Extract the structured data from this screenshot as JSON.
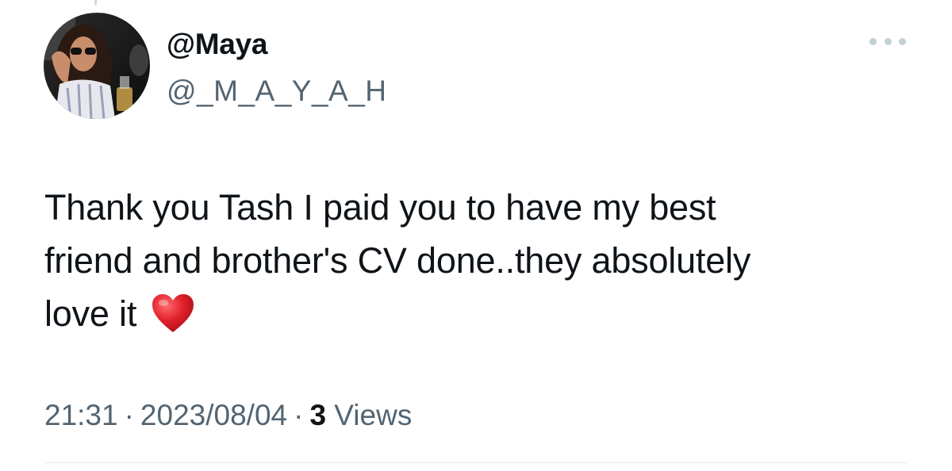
{
  "tweet": {
    "display_name": "@Maya",
    "handle": "@_M_A_Y_A_H",
    "more_icon": "more-horizontal-icon",
    "text_lines": [
      "Thank you Tash I paid you to have my best",
      "friend and brother's CV done..they absolutely",
      "love it"
    ],
    "emoji": "red-heart-icon",
    "time": "21:31",
    "date": "2023/08/04",
    "separator": "·",
    "views_count": "3",
    "views_label": "Views"
  },
  "colors": {
    "text_primary": "#0f1419",
    "text_secondary": "#536471",
    "heart": "#e0202b",
    "divider": "#e1e8ed"
  }
}
